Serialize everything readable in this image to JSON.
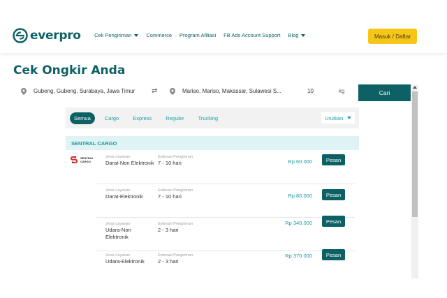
{
  "nav": {
    "logo_text": "everpro",
    "links": [
      {
        "label": "Cek Pengiriman",
        "has_caret": true
      },
      {
        "label": "Commerce",
        "has_caret": false
      },
      {
        "label": "Program Afiliasi",
        "has_caret": false
      },
      {
        "label": "FB Ads Account Support",
        "has_caret": false
      },
      {
        "label": "Blog",
        "has_caret": true
      }
    ],
    "login_label": "Masuk / Daftar"
  },
  "page_title": "Cek Ongkir Anda",
  "search": {
    "origin": "Gubeng, Gubeng, Surabaya, Jawa Timur",
    "destination": "Mariso, Mariso, Makassar, Sulawesi S...",
    "weight": "10",
    "unit": "kg",
    "submit_label": "Cari"
  },
  "filters": {
    "tabs": [
      "Semua",
      "Cargo",
      "Express",
      "Reguler",
      "Trucking"
    ],
    "active": "Semua",
    "sort_label": "Urutkan"
  },
  "section": {
    "title": "SENTRAL CARGO",
    "logo_text": "SENTRAL CARGO",
    "service_label": "Jenis Layanan",
    "estimate_label": "Estimasi Pengiriman",
    "order_label": "Pesan",
    "rows": [
      {
        "service": "Darat-Non Elektronik",
        "estimate": "7 - 10 hari",
        "price": "Rp 60.000"
      },
      {
        "service": "Darat-Elektronik",
        "estimate": "7 - 10 hari",
        "price": "Rp 80.000"
      },
      {
        "service": "Udara-Non Elektronik",
        "estimate": "2 - 3 hari",
        "price": "Rp 340.000"
      },
      {
        "service": "Udara-Elektronik",
        "estimate": "2 - 3 hari",
        "price": "Rp 370.000"
      }
    ]
  },
  "colors": {
    "brand": "#0d6165",
    "accent": "#f5c518",
    "link": "#1aa0a8"
  }
}
